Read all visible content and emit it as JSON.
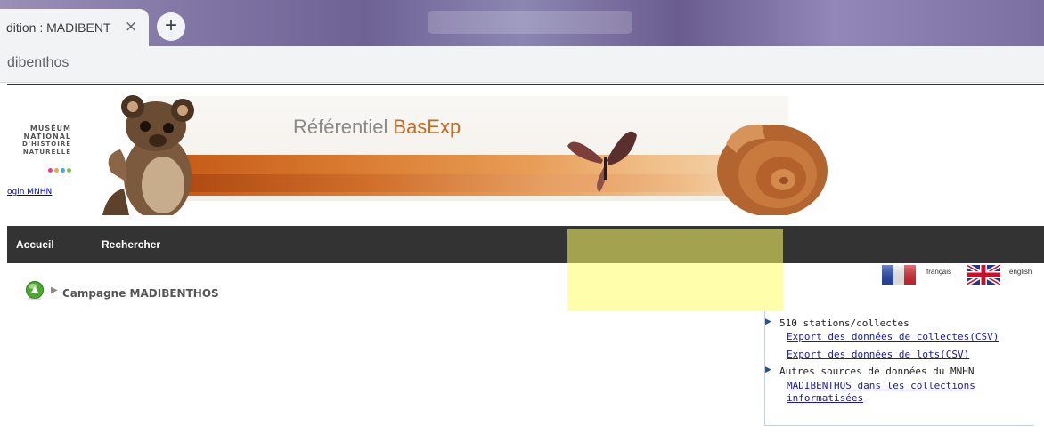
{
  "browser": {
    "tab_title": "dition : MADIBENT",
    "tab_close": "×",
    "new_tab": "+",
    "address": "dibenthos"
  },
  "header": {
    "logo_lines": [
      "MUSÉUM",
      "NATIONAL",
      "D'HISTOIRE",
      "NATURELLE"
    ],
    "logo_dot_colors": [
      "#e0457b",
      "#f2a93b",
      "#4aa8d8",
      "#7cc243"
    ],
    "login_link": "ogin MNHN",
    "banner_title": "Référentiel",
    "banner_title_highlight": "BasExp"
  },
  "nav": {
    "items": [
      "Accueil",
      "Rechercher"
    ]
  },
  "languages": {
    "french_label": "français",
    "english_label": "english"
  },
  "breadcrumb": {
    "current": "Campagne MADIBENTHOS"
  },
  "sidebox": {
    "stations": "510 stations/collectes",
    "export_collectes": "Export des données de collectes(CSV)",
    "export_lots": "Export des données de lots(CSV)",
    "other_sources": "Autres sources de données du MNHN",
    "collections_link_line1": "MADIBENTHOS dans les collections",
    "collections_link_line2": "informatisées"
  },
  "colors": {
    "nav_bg": "#333333",
    "link": "#1a1aa6",
    "highlight_overlay": "#ffff66",
    "banner_accent": "#c9681f"
  }
}
